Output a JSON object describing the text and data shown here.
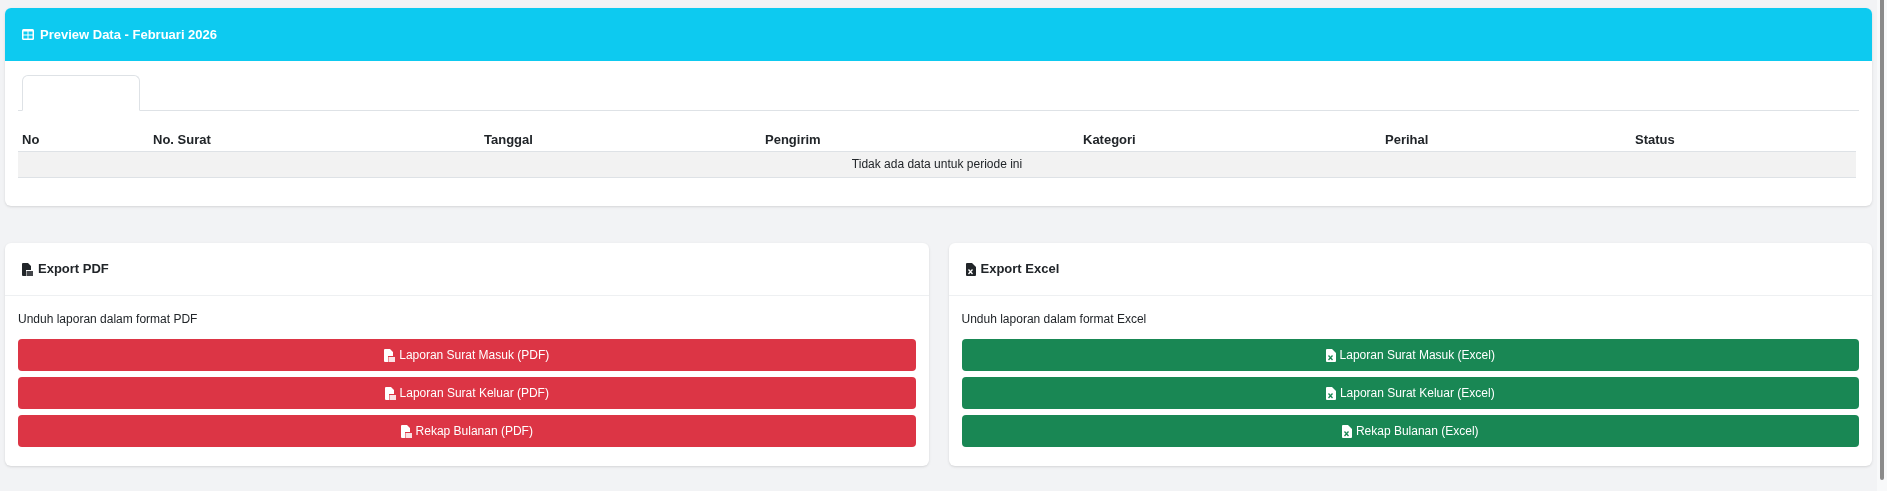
{
  "preview": {
    "title": "Preview Data - Februari 2026",
    "tabs": [
      {
        "selected": true
      }
    ],
    "table": {
      "columns": [
        "No",
        "No. Surat",
        "Tanggal",
        "Pengirim",
        "Kategori",
        "Perihal",
        "Status"
      ],
      "empty_message": "Tidak ada data untuk periode ini"
    }
  },
  "exports": [
    {
      "kind": "pdf",
      "title": "Export PDF",
      "description": "Unduh laporan dalam format PDF",
      "buttons": [
        "Laporan Surat Masuk (PDF)",
        "Laporan Surat Keluar (PDF)",
        "Rekap Bulanan (PDF)"
      ]
    },
    {
      "kind": "excel",
      "title": "Export Excel",
      "description": "Unduh laporan dalam format Excel",
      "buttons": [
        "Laporan Surat Masuk (Excel)",
        "Laporan Surat Keluar (Excel)",
        "Rekap Bulanan (Excel)"
      ]
    }
  ]
}
